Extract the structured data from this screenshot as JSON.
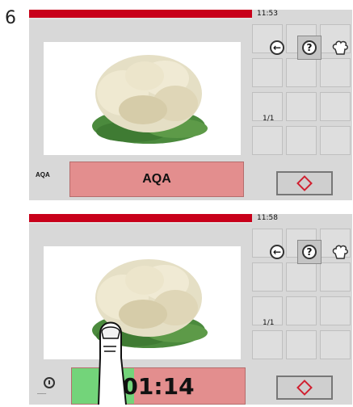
{
  "step_number": "6",
  "screens": [
    {
      "time": "11:53",
      "left_label": "AQA",
      "field_text": "AQA",
      "page_count": "1/1"
    },
    {
      "time": "11:58",
      "timer_value": "01:14",
      "timer_progress_percent": 36,
      "page_count": "1/1"
    }
  ],
  "icons": {
    "back": "back-arrow-icon",
    "help": "help-icon",
    "chef": "chef-hat-icon",
    "timer": "timer-icon",
    "start": "start-diamond-icon",
    "touch": "touching-finger-icon"
  },
  "colors": {
    "top_bar": "#c8001a",
    "field": "#e38e8e",
    "timer_fill": "#73d47a"
  }
}
